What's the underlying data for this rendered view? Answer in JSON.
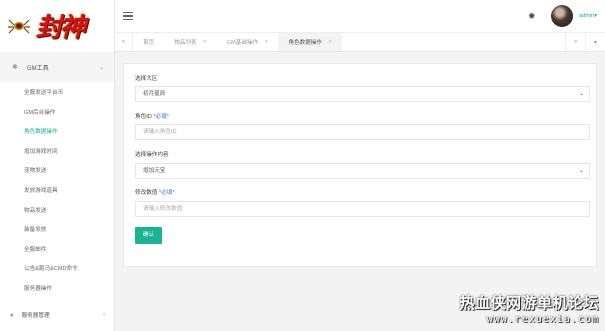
{
  "logo": {
    "text": "封神"
  },
  "sidebar": {
    "group1": {
      "icon": "gear-icon",
      "label": "GM工具"
    },
    "items": [
      {
        "label": "全服发送平台币"
      },
      {
        "label": "GM后台操作"
      },
      {
        "label": "角色数据操作",
        "active": true
      },
      {
        "label": "增加游戏时间"
      },
      {
        "label": "宠物发送"
      },
      {
        "label": "发放游戏道具"
      },
      {
        "label": "物品发送"
      },
      {
        "label": "装备发放"
      },
      {
        "label": "全服邮件"
      },
      {
        "label": "公告&跑马&CMD命令"
      },
      {
        "label": "服务器操作"
      }
    ],
    "group2": {
      "icon": "server-icon",
      "label": "服务器管理"
    }
  },
  "topbar": {
    "user": "admin"
  },
  "tabs": [
    {
      "label": "首页"
    },
    {
      "label": "物品列表"
    },
    {
      "label": "GM基础操作"
    },
    {
      "label": "角色数据操作",
      "active": true
    }
  ],
  "form": {
    "region": {
      "label": "选择大区",
      "value": "初月星辰"
    },
    "role_id": {
      "label": "角色ID",
      "hint": "*必填*",
      "placeholder": "请输入角色ID"
    },
    "operation": {
      "label": "选择操作内容",
      "value": "增加元宝"
    },
    "amount": {
      "label": "修改数值",
      "hint": "*必填*",
      "placeholder": "请输入修改数值"
    },
    "submit": "确认"
  },
  "watermark": {
    "title": "热血侠网游单机论坛",
    "url": "www.rexuexia.com"
  },
  "colors": {
    "accent": "#1ab394",
    "hint": "#3a78c3",
    "logo": "#d41414"
  }
}
